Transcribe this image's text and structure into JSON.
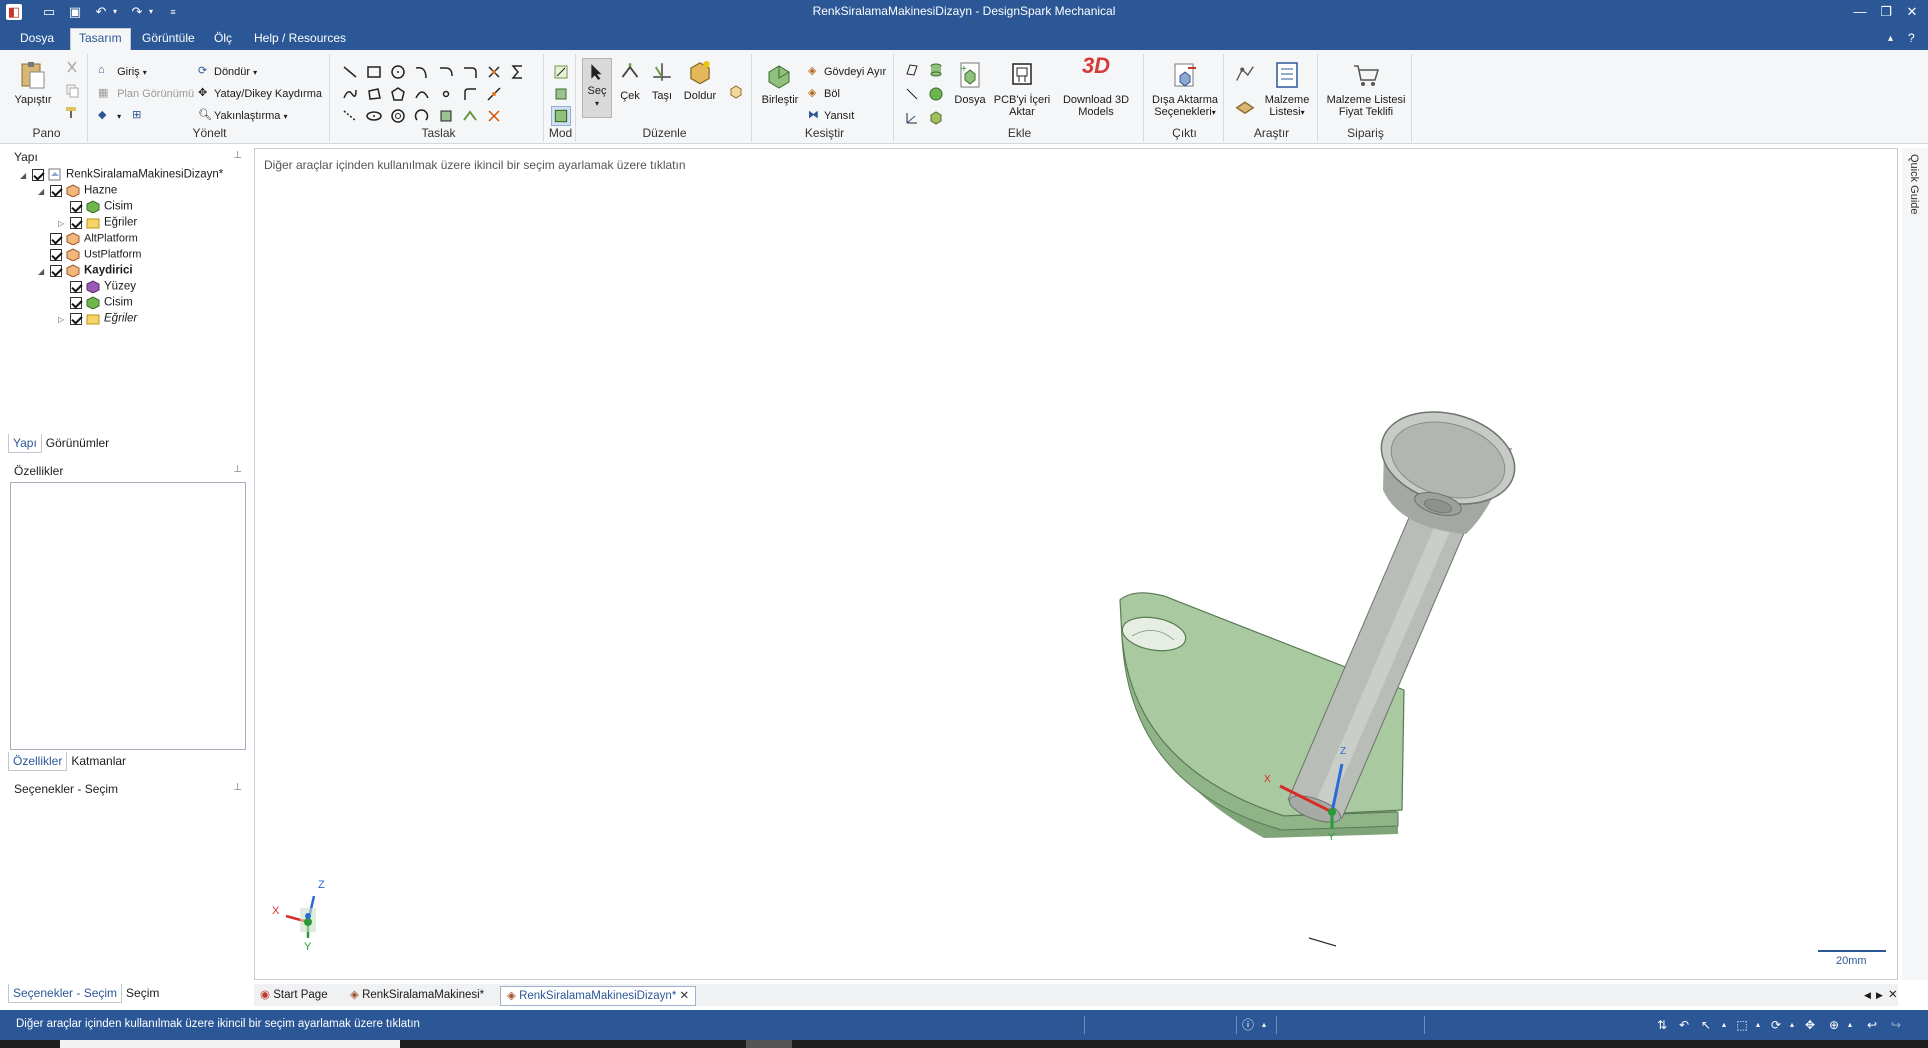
{
  "window": {
    "title": "RenkSiralamaMakinesiDizayn - DesignSpark Mechanical",
    "controls": [
      "minimize",
      "restore",
      "close"
    ]
  },
  "menu": {
    "tabs": [
      "Dosya",
      "Tasarım",
      "Görüntüle",
      "Ölç",
      "Help / Resources"
    ],
    "active": "Tasarım"
  },
  "ribbon": {
    "pano": {
      "label": "Pano",
      "paste": "Yapıştır"
    },
    "yonelt": {
      "label": "Yönelt",
      "giris": "Giriş",
      "plan": "Plan Görünümü",
      "dondur": "Döndür",
      "kaydirma": "Yatay/Dikey Kaydırma",
      "yakinlastirma": "Yakınlaştırma"
    },
    "taslak": {
      "label": "Taslak"
    },
    "mod": {
      "label": "Mod"
    },
    "duzenle": {
      "label": "Düzenle",
      "sec": "Seç",
      "cek": "Çek",
      "tasi": "Taşı",
      "doldur": "Doldur"
    },
    "kesistir": {
      "label": "Kesiştir",
      "birlestir": "Birleştir",
      "gvdeyi_ayir": "Gövdeyi Ayır",
      "bol": "Böl",
      "yansit": "Yansıt"
    },
    "ekle": {
      "label": "Ekle",
      "dosya": "Dosya",
      "pcb": "PCB'yi İçeri Aktar",
      "download": "Download 3D Models",
      "logo3d": "3D"
    },
    "cikti": {
      "label": "Çıktı",
      "disa": "Dışa Aktarma Seçenekleri"
    },
    "arastir": {
      "label": "Araştır",
      "malzeme": "Malzeme Listesi"
    },
    "siparis": {
      "label": "Sipariş",
      "fiyat": "Malzeme Listesi Fiyat Teklifi"
    }
  },
  "structure_pane": {
    "title": "Yapı",
    "tree": [
      {
        "label": "RenkSiralamaMakinesiDizayn*",
        "level": 0,
        "expanded": true
      },
      {
        "label": "Hazne",
        "level": 1,
        "expanded": true
      },
      {
        "label": "Cisim",
        "level": 2
      },
      {
        "label": "Eğriler",
        "level": 2,
        "expanded": false
      },
      {
        "label": "AltPlatform",
        "level": 1
      },
      {
        "label": "UstPlatform",
        "level": 1
      },
      {
        "label": "Kaydirici",
        "level": 1,
        "expanded": true,
        "bold": true
      },
      {
        "label": "Yüzey",
        "level": 2
      },
      {
        "label": "Cisim",
        "level": 2
      },
      {
        "label": "Eğriler",
        "level": 2,
        "expanded": false,
        "italic": true
      }
    ],
    "tabs": [
      "Yapı",
      "Görünümler"
    ]
  },
  "properties_pane": {
    "title": "Özellikler",
    "tabs": [
      "Özellikler",
      "Katmanlar"
    ]
  },
  "options_pane": {
    "title": "Seçenekler - Seçim",
    "tabs": [
      "Seçenekler - Seçim",
      "Seçim"
    ]
  },
  "viewport": {
    "hint": "Diğer araçlar içinden kullanılmak üzere ikincil bir seçim ayarlamak üzere tıklatın",
    "scale_label": "20mm",
    "axis": {
      "x": "X",
      "y": "Y",
      "z": "Z"
    }
  },
  "doc_tabs": [
    "Start Page",
    "RenkSiralamaMakinesi*",
    "RenkSiralamaMakinesiDizayn*"
  ],
  "doc_tab_active": "RenkSiralamaMakinesiDizayn*",
  "side_panel": {
    "label": "Quick Guide"
  },
  "status": {
    "text": "Diğer araçlar içinden kullanılmak üzere ikincil bir seçim ayarlamak üzere tıklatın"
  },
  "colors": {
    "chrome": "#2b5797",
    "part_green": "#a8c8a0",
    "funnel_gray": "#b9bdb8"
  }
}
